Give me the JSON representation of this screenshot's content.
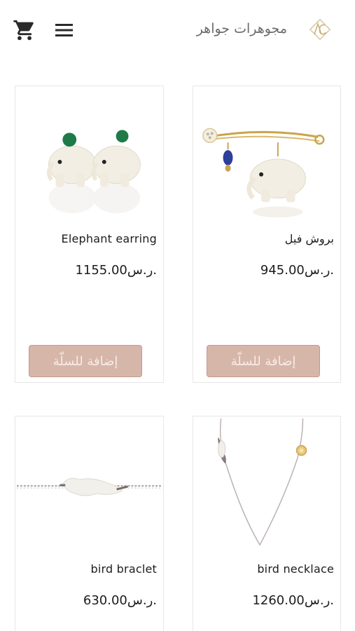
{
  "header": {
    "brand_name": "مجوهرات جواهر",
    "logo_icon": "jawaher-logo-icon",
    "cart_icon": "shopping-cart-icon",
    "menu_icon": "hamburger-menu-icon"
  },
  "colors": {
    "button_bg": "#d7b6aa",
    "button_border": "#c39a8b",
    "button_text": "#f6ece7",
    "card_border": "#e7e7e7"
  },
  "products": [
    {
      "name": "Elephant earring",
      "price": "1155.00ر.س.",
      "button_label": "إضافة للسلّة"
    },
    {
      "name": "بروش فيل",
      "price": "945.00ر.س.",
      "button_label": "إضافة للسلّة"
    },
    {
      "name": "bird braclet",
      "price": "630.00ر.س."
    },
    {
      "name": "bird necklace",
      "price": "1260.00ر.س."
    }
  ]
}
